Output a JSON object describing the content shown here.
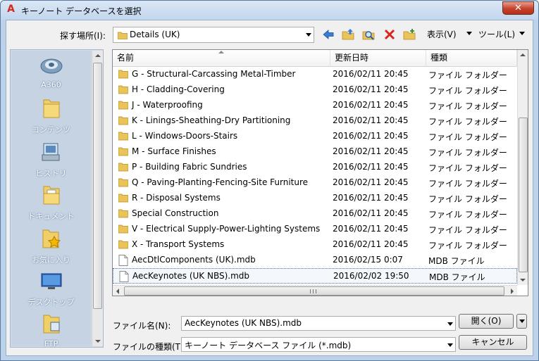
{
  "window": {
    "title": "キーノート データベースを選択",
    "app_icon": "A",
    "close_glyph": "✕"
  },
  "lookin": {
    "label": "探す場所(I):",
    "value": "Details (UK)"
  },
  "toolbar": {
    "view_menu": "表示(V)",
    "tools_menu": "ツール(L)",
    "icons": [
      "back-arrow-icon",
      "up-folder-icon",
      "search-web-icon",
      "delete-icon",
      "new-folder-icon"
    ]
  },
  "places": [
    {
      "label": "A360",
      "icon": "a360-icon"
    },
    {
      "label": "コンテンツ",
      "icon": "folder-icon"
    },
    {
      "label": "ヒストリ",
      "icon": "history-icon"
    },
    {
      "label": "ドキュメント",
      "icon": "documents-icon"
    },
    {
      "label": "お気に入り",
      "icon": "favorites-icon"
    },
    {
      "label": "デスクトップ",
      "icon": "desktop-icon"
    },
    {
      "label": "FTP",
      "icon": "ftp-icon"
    }
  ],
  "list": {
    "columns": [
      "名前",
      "更新日時",
      "種類"
    ],
    "rows": [
      {
        "name": "G - Structural-Carcassing Metal-Timber",
        "date": "2016/02/11 20:45",
        "type": "ファイル フォルダー",
        "icon": "folder"
      },
      {
        "name": "H - Cladding-Covering",
        "date": "2016/02/11 20:45",
        "type": "ファイル フォルダー",
        "icon": "folder"
      },
      {
        "name": "J - Waterproofing",
        "date": "2016/02/11 20:45",
        "type": "ファイル フォルダー",
        "icon": "folder"
      },
      {
        "name": "K - Linings-Sheathing-Dry Partitioning",
        "date": "2016/02/11 20:45",
        "type": "ファイル フォルダー",
        "icon": "folder"
      },
      {
        "name": "L - Windows-Doors-Stairs",
        "date": "2016/02/11 20:45",
        "type": "ファイル フォルダー",
        "icon": "folder"
      },
      {
        "name": "M - Surface Finishes",
        "date": "2016/02/11 20:45",
        "type": "ファイル フォルダー",
        "icon": "folder"
      },
      {
        "name": "P - Building Fabric Sundries",
        "date": "2016/02/11 20:45",
        "type": "ファイル フォルダー",
        "icon": "folder"
      },
      {
        "name": "Q - Paving-Planting-Fencing-Site Furniture",
        "date": "2016/02/11 20:45",
        "type": "ファイル フォルダー",
        "icon": "folder"
      },
      {
        "name": "R - Disposal Systems",
        "date": "2016/02/11 20:45",
        "type": "ファイル フォルダー",
        "icon": "folder"
      },
      {
        "name": "Special Construction",
        "date": "2016/02/11 20:45",
        "type": "ファイル フォルダー",
        "icon": "folder"
      },
      {
        "name": "V - Electrical Supply-Power-Lighting Systems",
        "date": "2016/02/11 20:45",
        "type": "ファイル フォルダー",
        "icon": "folder"
      },
      {
        "name": "X - Transport Systems",
        "date": "2016/02/11 20:45",
        "type": "ファイル フォルダー",
        "icon": "folder"
      },
      {
        "name": "AecDtlComponents (UK).mdb",
        "date": "2016/02/15 0:07",
        "type": "MDB ファイル",
        "icon": "file"
      },
      {
        "name": "AecKeynotes (UK NBS).mdb",
        "date": "2016/02/02 19:50",
        "type": "MDB ファイル",
        "icon": "file",
        "selected": true
      }
    ]
  },
  "filename": {
    "label": "ファイル名(N):",
    "value": "AecKeynotes (UK NBS).mdb"
  },
  "filetype": {
    "label": "ファイルの種類(T):",
    "value": "キーノート データベース ファイル (*.mdb)"
  },
  "buttons": {
    "open": "開く(O)",
    "cancel": "キャンセル"
  },
  "colors": {
    "accent": "#d8261a",
    "close_red": "#c6412b",
    "frame": "#bcd2ea",
    "places_bg": "#c6d3e3"
  }
}
